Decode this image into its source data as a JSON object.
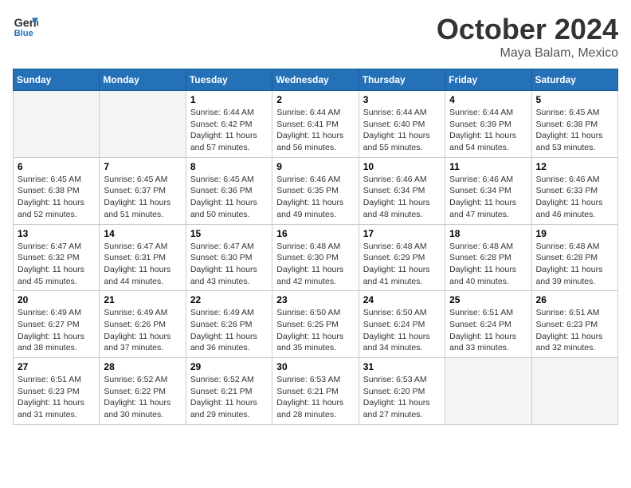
{
  "header": {
    "logo_text_general": "General",
    "logo_text_blue": "Blue",
    "title": "October 2024",
    "subtitle": "Maya Balam, Mexico"
  },
  "weekdays": [
    "Sunday",
    "Monday",
    "Tuesday",
    "Wednesday",
    "Thursday",
    "Friday",
    "Saturday"
  ],
  "weeks": [
    [
      {
        "day": "",
        "sunrise": "",
        "sunset": "",
        "daylight": "",
        "empty": true
      },
      {
        "day": "",
        "sunrise": "",
        "sunset": "",
        "daylight": "",
        "empty": true
      },
      {
        "day": "1",
        "sunrise": "Sunrise: 6:44 AM",
        "sunset": "Sunset: 6:42 PM",
        "daylight": "Daylight: 11 hours and 57 minutes.",
        "empty": false
      },
      {
        "day": "2",
        "sunrise": "Sunrise: 6:44 AM",
        "sunset": "Sunset: 6:41 PM",
        "daylight": "Daylight: 11 hours and 56 minutes.",
        "empty": false
      },
      {
        "day": "3",
        "sunrise": "Sunrise: 6:44 AM",
        "sunset": "Sunset: 6:40 PM",
        "daylight": "Daylight: 11 hours and 55 minutes.",
        "empty": false
      },
      {
        "day": "4",
        "sunrise": "Sunrise: 6:44 AM",
        "sunset": "Sunset: 6:39 PM",
        "daylight": "Daylight: 11 hours and 54 minutes.",
        "empty": false
      },
      {
        "day": "5",
        "sunrise": "Sunrise: 6:45 AM",
        "sunset": "Sunset: 6:38 PM",
        "daylight": "Daylight: 11 hours and 53 minutes.",
        "empty": false
      }
    ],
    [
      {
        "day": "6",
        "sunrise": "Sunrise: 6:45 AM",
        "sunset": "Sunset: 6:38 PM",
        "daylight": "Daylight: 11 hours and 52 minutes.",
        "empty": false
      },
      {
        "day": "7",
        "sunrise": "Sunrise: 6:45 AM",
        "sunset": "Sunset: 6:37 PM",
        "daylight": "Daylight: 11 hours and 51 minutes.",
        "empty": false
      },
      {
        "day": "8",
        "sunrise": "Sunrise: 6:45 AM",
        "sunset": "Sunset: 6:36 PM",
        "daylight": "Daylight: 11 hours and 50 minutes.",
        "empty": false
      },
      {
        "day": "9",
        "sunrise": "Sunrise: 6:46 AM",
        "sunset": "Sunset: 6:35 PM",
        "daylight": "Daylight: 11 hours and 49 minutes.",
        "empty": false
      },
      {
        "day": "10",
        "sunrise": "Sunrise: 6:46 AM",
        "sunset": "Sunset: 6:34 PM",
        "daylight": "Daylight: 11 hours and 48 minutes.",
        "empty": false
      },
      {
        "day": "11",
        "sunrise": "Sunrise: 6:46 AM",
        "sunset": "Sunset: 6:34 PM",
        "daylight": "Daylight: 11 hours and 47 minutes.",
        "empty": false
      },
      {
        "day": "12",
        "sunrise": "Sunrise: 6:46 AM",
        "sunset": "Sunset: 6:33 PM",
        "daylight": "Daylight: 11 hours and 46 minutes.",
        "empty": false
      }
    ],
    [
      {
        "day": "13",
        "sunrise": "Sunrise: 6:47 AM",
        "sunset": "Sunset: 6:32 PM",
        "daylight": "Daylight: 11 hours and 45 minutes.",
        "empty": false
      },
      {
        "day": "14",
        "sunrise": "Sunrise: 6:47 AM",
        "sunset": "Sunset: 6:31 PM",
        "daylight": "Daylight: 11 hours and 44 minutes.",
        "empty": false
      },
      {
        "day": "15",
        "sunrise": "Sunrise: 6:47 AM",
        "sunset": "Sunset: 6:30 PM",
        "daylight": "Daylight: 11 hours and 43 minutes.",
        "empty": false
      },
      {
        "day": "16",
        "sunrise": "Sunrise: 6:48 AM",
        "sunset": "Sunset: 6:30 PM",
        "daylight": "Daylight: 11 hours and 42 minutes.",
        "empty": false
      },
      {
        "day": "17",
        "sunrise": "Sunrise: 6:48 AM",
        "sunset": "Sunset: 6:29 PM",
        "daylight": "Daylight: 11 hours and 41 minutes.",
        "empty": false
      },
      {
        "day": "18",
        "sunrise": "Sunrise: 6:48 AM",
        "sunset": "Sunset: 6:28 PM",
        "daylight": "Daylight: 11 hours and 40 minutes.",
        "empty": false
      },
      {
        "day": "19",
        "sunrise": "Sunrise: 6:48 AM",
        "sunset": "Sunset: 6:28 PM",
        "daylight": "Daylight: 11 hours and 39 minutes.",
        "empty": false
      }
    ],
    [
      {
        "day": "20",
        "sunrise": "Sunrise: 6:49 AM",
        "sunset": "Sunset: 6:27 PM",
        "daylight": "Daylight: 11 hours and 38 minutes.",
        "empty": false
      },
      {
        "day": "21",
        "sunrise": "Sunrise: 6:49 AM",
        "sunset": "Sunset: 6:26 PM",
        "daylight": "Daylight: 11 hours and 37 minutes.",
        "empty": false
      },
      {
        "day": "22",
        "sunrise": "Sunrise: 6:49 AM",
        "sunset": "Sunset: 6:26 PM",
        "daylight": "Daylight: 11 hours and 36 minutes.",
        "empty": false
      },
      {
        "day": "23",
        "sunrise": "Sunrise: 6:50 AM",
        "sunset": "Sunset: 6:25 PM",
        "daylight": "Daylight: 11 hours and 35 minutes.",
        "empty": false
      },
      {
        "day": "24",
        "sunrise": "Sunrise: 6:50 AM",
        "sunset": "Sunset: 6:24 PM",
        "daylight": "Daylight: 11 hours and 34 minutes.",
        "empty": false
      },
      {
        "day": "25",
        "sunrise": "Sunrise: 6:51 AM",
        "sunset": "Sunset: 6:24 PM",
        "daylight": "Daylight: 11 hours and 33 minutes.",
        "empty": false
      },
      {
        "day": "26",
        "sunrise": "Sunrise: 6:51 AM",
        "sunset": "Sunset: 6:23 PM",
        "daylight": "Daylight: 11 hours and 32 minutes.",
        "empty": false
      }
    ],
    [
      {
        "day": "27",
        "sunrise": "Sunrise: 6:51 AM",
        "sunset": "Sunset: 6:23 PM",
        "daylight": "Daylight: 11 hours and 31 minutes.",
        "empty": false
      },
      {
        "day": "28",
        "sunrise": "Sunrise: 6:52 AM",
        "sunset": "Sunset: 6:22 PM",
        "daylight": "Daylight: 11 hours and 30 minutes.",
        "empty": false
      },
      {
        "day": "29",
        "sunrise": "Sunrise: 6:52 AM",
        "sunset": "Sunset: 6:21 PM",
        "daylight": "Daylight: 11 hours and 29 minutes.",
        "empty": false
      },
      {
        "day": "30",
        "sunrise": "Sunrise: 6:53 AM",
        "sunset": "Sunset: 6:21 PM",
        "daylight": "Daylight: 11 hours and 28 minutes.",
        "empty": false
      },
      {
        "day": "31",
        "sunrise": "Sunrise: 6:53 AM",
        "sunset": "Sunset: 6:20 PM",
        "daylight": "Daylight: 11 hours and 27 minutes.",
        "empty": false
      },
      {
        "day": "",
        "sunrise": "",
        "sunset": "",
        "daylight": "",
        "empty": true
      },
      {
        "day": "",
        "sunrise": "",
        "sunset": "",
        "daylight": "",
        "empty": true
      }
    ]
  ]
}
